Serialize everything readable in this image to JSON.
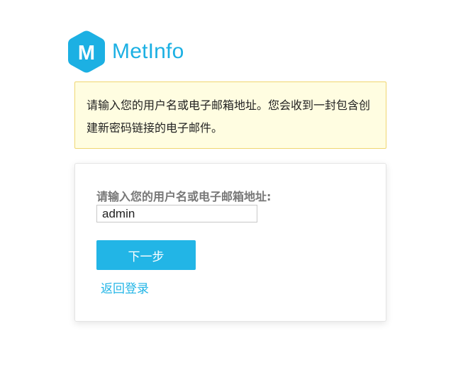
{
  "brand": {
    "name": "MetInfo",
    "mark_letter": "M",
    "color": "#1cb0e3"
  },
  "notice": {
    "text": "请输入您的用户名或电子邮箱地址。您会收到一封包含创建新密码链接的电子邮件。",
    "background": "#fffde1",
    "border_color": "#f0d671"
  },
  "form": {
    "label": "请输入您的用户名或电子邮箱地址:",
    "username_value": "admin",
    "next_button_label": "下一步",
    "back_link_label": "返回登录",
    "accent_color": "#22b5e6"
  },
  "icons": {
    "logo": "hexagon-m-logo-icon"
  }
}
